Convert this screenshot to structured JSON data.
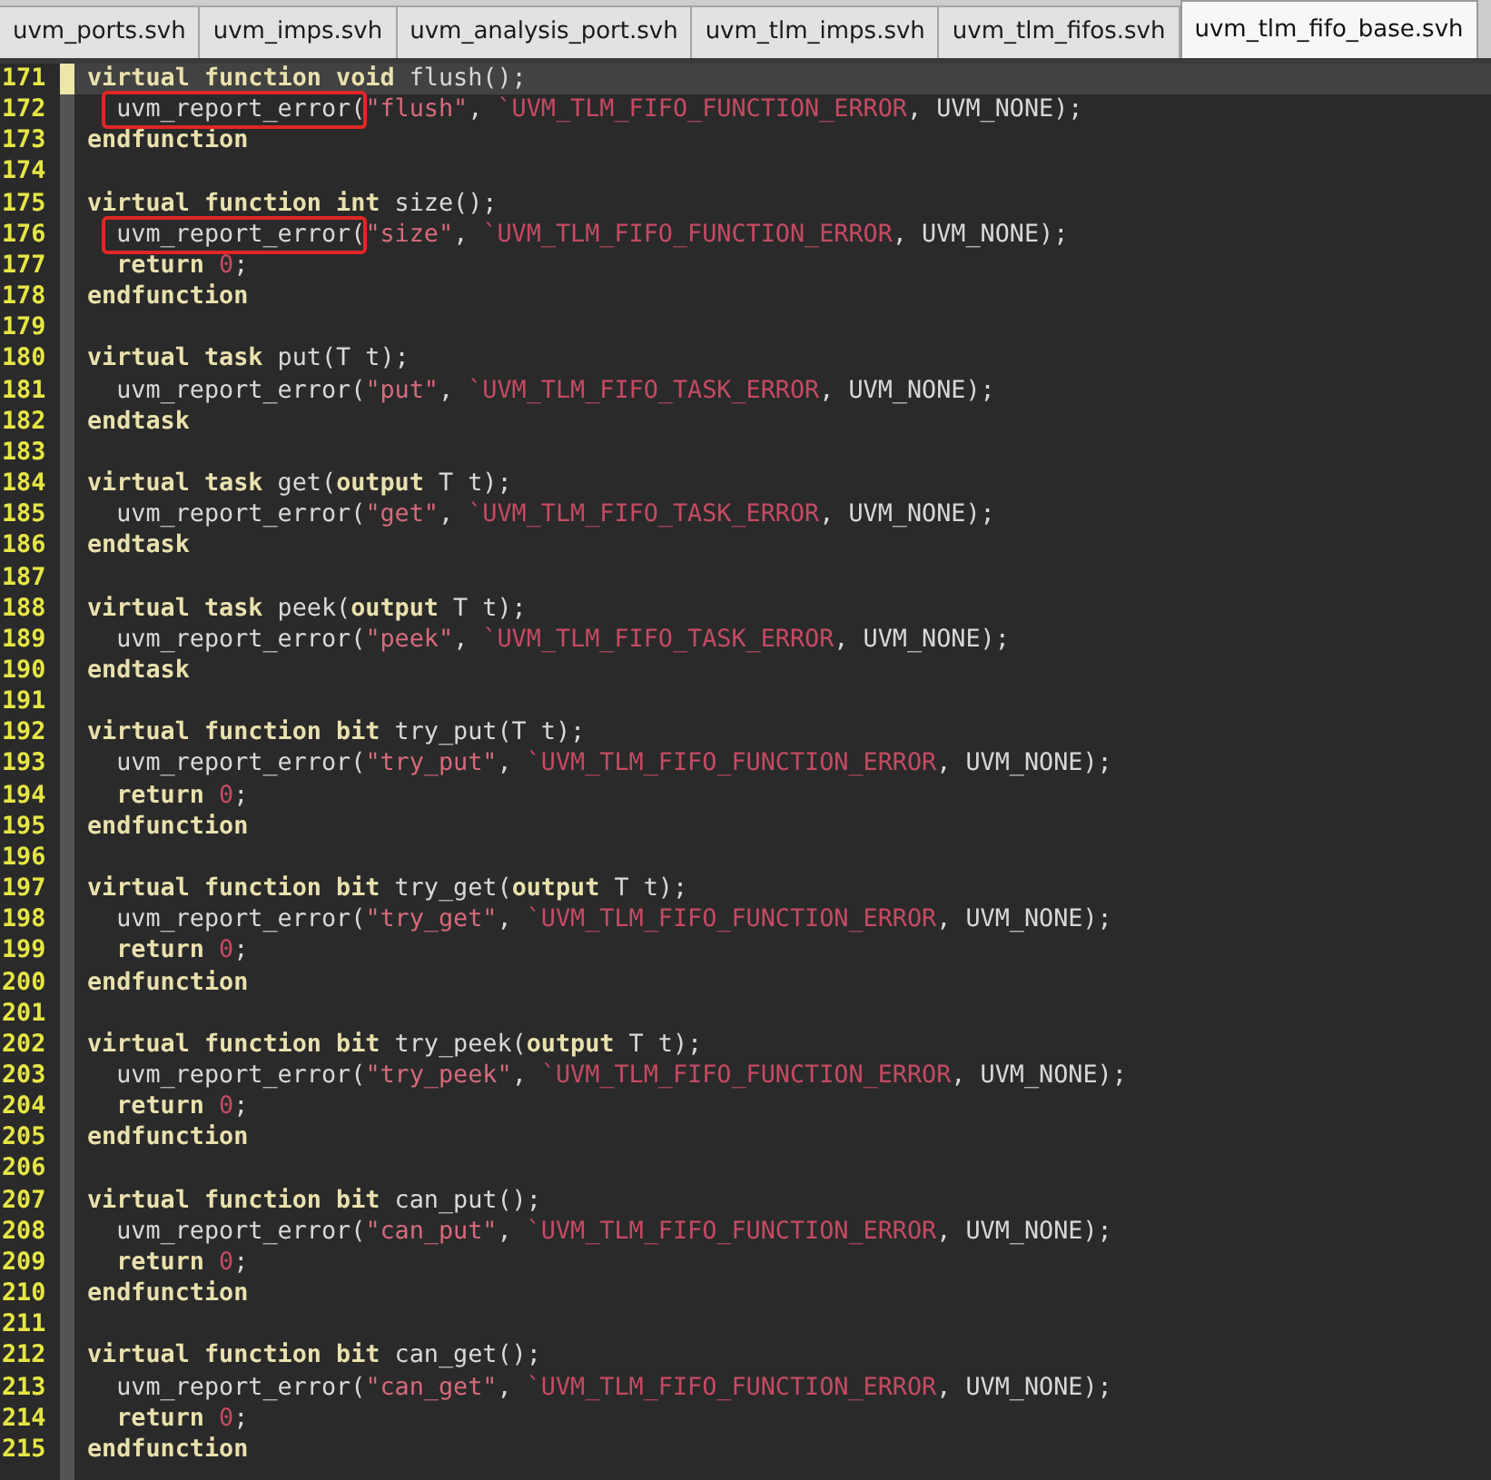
{
  "tabs": [
    {
      "label": "uvm_ports.svh",
      "selected": false
    },
    {
      "label": "uvm_imps.svh",
      "selected": false
    },
    {
      "label": "uvm_analysis_port.svh",
      "selected": false
    },
    {
      "label": "uvm_tlm_imps.svh",
      "selected": false
    },
    {
      "label": "uvm_tlm_fifos.svh",
      "selected": false
    },
    {
      "label": "uvm_tlm_fifo_base.svh",
      "selected": true
    }
  ],
  "lines": [
    {
      "number": "171",
      "current": true,
      "annotated": false,
      "tokens": [
        {
          "kind": "keyword",
          "text": "virtual function void"
        },
        {
          "kind": "text",
          "text": " flush();"
        }
      ]
    },
    {
      "number": "172",
      "current": false,
      "annotated": true,
      "tokens": [
        {
          "kind": "text",
          "text": "  uvm_report_error("
        },
        {
          "kind": "string",
          "text": "\"flush\""
        },
        {
          "kind": "text",
          "text": ", "
        },
        {
          "kind": "macro",
          "text": "`UVM_TLM_FIFO_FUNCTION_ERROR"
        },
        {
          "kind": "text",
          "text": ", UVM_NONE);"
        }
      ]
    },
    {
      "number": "173",
      "current": false,
      "annotated": false,
      "tokens": [
        {
          "kind": "keyword",
          "text": "endfunction"
        }
      ]
    },
    {
      "number": "174",
      "current": false,
      "annotated": false
    },
    {
      "number": "175",
      "current": false,
      "annotated": false,
      "tokens": [
        {
          "kind": "keyword",
          "text": "virtual function int"
        },
        {
          "kind": "text",
          "text": " size();"
        }
      ]
    },
    {
      "number": "176",
      "current": false,
      "annotated": true,
      "tokens": [
        {
          "kind": "text",
          "text": "  uvm_report_error("
        },
        {
          "kind": "string",
          "text": "\"size\""
        },
        {
          "kind": "text",
          "text": ", "
        },
        {
          "kind": "macro",
          "text": "`UVM_TLM_FIFO_FUNCTION_ERROR"
        },
        {
          "kind": "text",
          "text": ", UVM_NONE);"
        }
      ]
    },
    {
      "number": "177",
      "current": false,
      "annotated": false,
      "tokens": [
        {
          "kind": "keyword",
          "text": "  return"
        },
        {
          "kind": "number",
          "text": " 0"
        },
        {
          "kind": "text",
          "text": ";"
        }
      ]
    },
    {
      "number": "178",
      "current": false,
      "annotated": false,
      "tokens": [
        {
          "kind": "keyword",
          "text": "endfunction"
        }
      ]
    },
    {
      "number": "179",
      "current": false,
      "annotated": false
    },
    {
      "number": "180",
      "current": false,
      "annotated": false,
      "tokens": [
        {
          "kind": "keyword",
          "text": "virtual task"
        },
        {
          "kind": "text",
          "text": " put(T t);"
        }
      ]
    },
    {
      "number": "181",
      "current": false,
      "annotated": false,
      "tokens": [
        {
          "kind": "text",
          "text": "  uvm_report_error("
        },
        {
          "kind": "string",
          "text": "\"put\""
        },
        {
          "kind": "text",
          "text": ", "
        },
        {
          "kind": "macro",
          "text": "`UVM_TLM_FIFO_TASK_ERROR"
        },
        {
          "kind": "text",
          "text": ", UVM_NONE);"
        }
      ]
    },
    {
      "number": "182",
      "current": false,
      "annotated": false,
      "tokens": [
        {
          "kind": "keyword",
          "text": "endtask"
        }
      ]
    },
    {
      "number": "183",
      "current": false,
      "annotated": false
    },
    {
      "number": "184",
      "current": false,
      "annotated": false,
      "tokens": [
        {
          "kind": "keyword",
          "text": "virtual task"
        },
        {
          "kind": "text",
          "text": " get("
        },
        {
          "kind": "keyword",
          "text": "output"
        },
        {
          "kind": "text",
          "text": " T t);"
        }
      ]
    },
    {
      "number": "185",
      "current": false,
      "annotated": false,
      "tokens": [
        {
          "kind": "text",
          "text": "  uvm_report_error("
        },
        {
          "kind": "string",
          "text": "\"get\""
        },
        {
          "kind": "text",
          "text": ", "
        },
        {
          "kind": "macro",
          "text": "`UVM_TLM_FIFO_TASK_ERROR"
        },
        {
          "kind": "text",
          "text": ", UVM_NONE);"
        }
      ]
    },
    {
      "number": "186",
      "current": false,
      "annotated": false,
      "tokens": [
        {
          "kind": "keyword",
          "text": "endtask"
        }
      ]
    },
    {
      "number": "187",
      "current": false,
      "annotated": false
    },
    {
      "number": "188",
      "current": false,
      "annotated": false,
      "tokens": [
        {
          "kind": "keyword",
          "text": "virtual task"
        },
        {
          "kind": "text",
          "text": " peek("
        },
        {
          "kind": "keyword",
          "text": "output"
        },
        {
          "kind": "text",
          "text": " T t);"
        }
      ]
    },
    {
      "number": "189",
      "current": false,
      "annotated": false,
      "tokens": [
        {
          "kind": "text",
          "text": "  uvm_report_error("
        },
        {
          "kind": "string",
          "text": "\"peek\""
        },
        {
          "kind": "text",
          "text": ", "
        },
        {
          "kind": "macro",
          "text": "`UVM_TLM_FIFO_TASK_ERROR"
        },
        {
          "kind": "text",
          "text": ", UVM_NONE);"
        }
      ]
    },
    {
      "number": "190",
      "current": false,
      "annotated": false,
      "tokens": [
        {
          "kind": "keyword",
          "text": "endtask"
        }
      ]
    },
    {
      "number": "191",
      "current": false,
      "annotated": false
    },
    {
      "number": "192",
      "current": false,
      "annotated": false,
      "tokens": [
        {
          "kind": "keyword",
          "text": "virtual function bit"
        },
        {
          "kind": "text",
          "text": " try_put(T t);"
        }
      ]
    },
    {
      "number": "193",
      "current": false,
      "annotated": false,
      "tokens": [
        {
          "kind": "text",
          "text": "  uvm_report_error("
        },
        {
          "kind": "string",
          "text": "\"try_put\""
        },
        {
          "kind": "text",
          "text": ", "
        },
        {
          "kind": "macro",
          "text": "`UVM_TLM_FIFO_FUNCTION_ERROR"
        },
        {
          "kind": "text",
          "text": ", UVM_NONE);"
        }
      ]
    },
    {
      "number": "194",
      "current": false,
      "annotated": false,
      "tokens": [
        {
          "kind": "keyword",
          "text": "  return"
        },
        {
          "kind": "number",
          "text": " 0"
        },
        {
          "kind": "text",
          "text": ";"
        }
      ]
    },
    {
      "number": "195",
      "current": false,
      "annotated": false,
      "tokens": [
        {
          "kind": "keyword",
          "text": "endfunction"
        }
      ]
    },
    {
      "number": "196",
      "current": false,
      "annotated": false
    },
    {
      "number": "197",
      "current": false,
      "annotated": false,
      "tokens": [
        {
          "kind": "keyword",
          "text": "virtual function bit"
        },
        {
          "kind": "text",
          "text": " try_get("
        },
        {
          "kind": "keyword",
          "text": "output"
        },
        {
          "kind": "text",
          "text": " T t);"
        }
      ]
    },
    {
      "number": "198",
      "current": false,
      "annotated": false,
      "tokens": [
        {
          "kind": "text",
          "text": "  uvm_report_error("
        },
        {
          "kind": "string",
          "text": "\"try_get\""
        },
        {
          "kind": "text",
          "text": ", "
        },
        {
          "kind": "macro",
          "text": "`UVM_TLM_FIFO_FUNCTION_ERROR"
        },
        {
          "kind": "text",
          "text": ", UVM_NONE);"
        }
      ]
    },
    {
      "number": "199",
      "current": false,
      "annotated": false,
      "tokens": [
        {
          "kind": "keyword",
          "text": "  return"
        },
        {
          "kind": "number",
          "text": " 0"
        },
        {
          "kind": "text",
          "text": ";"
        }
      ]
    },
    {
      "number": "200",
      "current": false,
      "annotated": false,
      "tokens": [
        {
          "kind": "keyword",
          "text": "endfunction"
        }
      ]
    },
    {
      "number": "201",
      "current": false,
      "annotated": false
    },
    {
      "number": "202",
      "current": false,
      "annotated": false,
      "tokens": [
        {
          "kind": "keyword",
          "text": "virtual function bit"
        },
        {
          "kind": "text",
          "text": " try_peek("
        },
        {
          "kind": "keyword",
          "text": "output"
        },
        {
          "kind": "text",
          "text": " T t);"
        }
      ]
    },
    {
      "number": "203",
      "current": false,
      "annotated": false,
      "tokens": [
        {
          "kind": "text",
          "text": "  uvm_report_error("
        },
        {
          "kind": "string",
          "text": "\"try_peek\""
        },
        {
          "kind": "text",
          "text": ", "
        },
        {
          "kind": "macro",
          "text": "`UVM_TLM_FIFO_FUNCTION_ERROR"
        },
        {
          "kind": "text",
          "text": ", UVM_NONE);"
        }
      ]
    },
    {
      "number": "204",
      "current": false,
      "annotated": false,
      "tokens": [
        {
          "kind": "keyword",
          "text": "  return"
        },
        {
          "kind": "number",
          "text": " 0"
        },
        {
          "kind": "text",
          "text": ";"
        }
      ]
    },
    {
      "number": "205",
      "current": false,
      "annotated": false,
      "tokens": [
        {
          "kind": "keyword",
          "text": "endfunction"
        }
      ]
    },
    {
      "number": "206",
      "current": false,
      "annotated": false
    },
    {
      "number": "207",
      "current": false,
      "annotated": false,
      "tokens": [
        {
          "kind": "keyword",
          "text": "virtual function bit"
        },
        {
          "kind": "text",
          "text": " can_put();"
        }
      ]
    },
    {
      "number": "208",
      "current": false,
      "annotated": false,
      "tokens": [
        {
          "kind": "text",
          "text": "  uvm_report_error("
        },
        {
          "kind": "string",
          "text": "\"can_put\""
        },
        {
          "kind": "text",
          "text": ", "
        },
        {
          "kind": "macro",
          "text": "`UVM_TLM_FIFO_FUNCTION_ERROR"
        },
        {
          "kind": "text",
          "text": ", UVM_NONE);"
        }
      ]
    },
    {
      "number": "209",
      "current": false,
      "annotated": false,
      "tokens": [
        {
          "kind": "keyword",
          "text": "  return"
        },
        {
          "kind": "number",
          "text": " 0"
        },
        {
          "kind": "text",
          "text": ";"
        }
      ]
    },
    {
      "number": "210",
      "current": false,
      "annotated": false,
      "tokens": [
        {
          "kind": "keyword",
          "text": "endfunction"
        }
      ]
    },
    {
      "number": "211",
      "current": false,
      "annotated": false
    },
    {
      "number": "212",
      "current": false,
      "annotated": false,
      "tokens": [
        {
          "kind": "keyword",
          "text": "virtual function bit"
        },
        {
          "kind": "text",
          "text": " can_get();"
        }
      ]
    },
    {
      "number": "213",
      "current": false,
      "annotated": false,
      "tokens": [
        {
          "kind": "text",
          "text": "  uvm_report_error("
        },
        {
          "kind": "string",
          "text": "\"can_get\""
        },
        {
          "kind": "text",
          "text": ", "
        },
        {
          "kind": "macro",
          "text": "`UVM_TLM_FIFO_FUNCTION_ERROR"
        },
        {
          "kind": "text",
          "text": ", UVM_NONE);"
        }
      ]
    },
    {
      "number": "214",
      "current": false,
      "annotated": false,
      "tokens": [
        {
          "kind": "keyword",
          "text": "  return"
        },
        {
          "kind": "number",
          "text": " 0"
        },
        {
          "kind": "text",
          "text": ";"
        }
      ]
    },
    {
      "number": "215",
      "current": false,
      "annotated": false,
      "tokens": [
        {
          "kind": "keyword",
          "text": "endfunction"
        }
      ]
    }
  ]
}
